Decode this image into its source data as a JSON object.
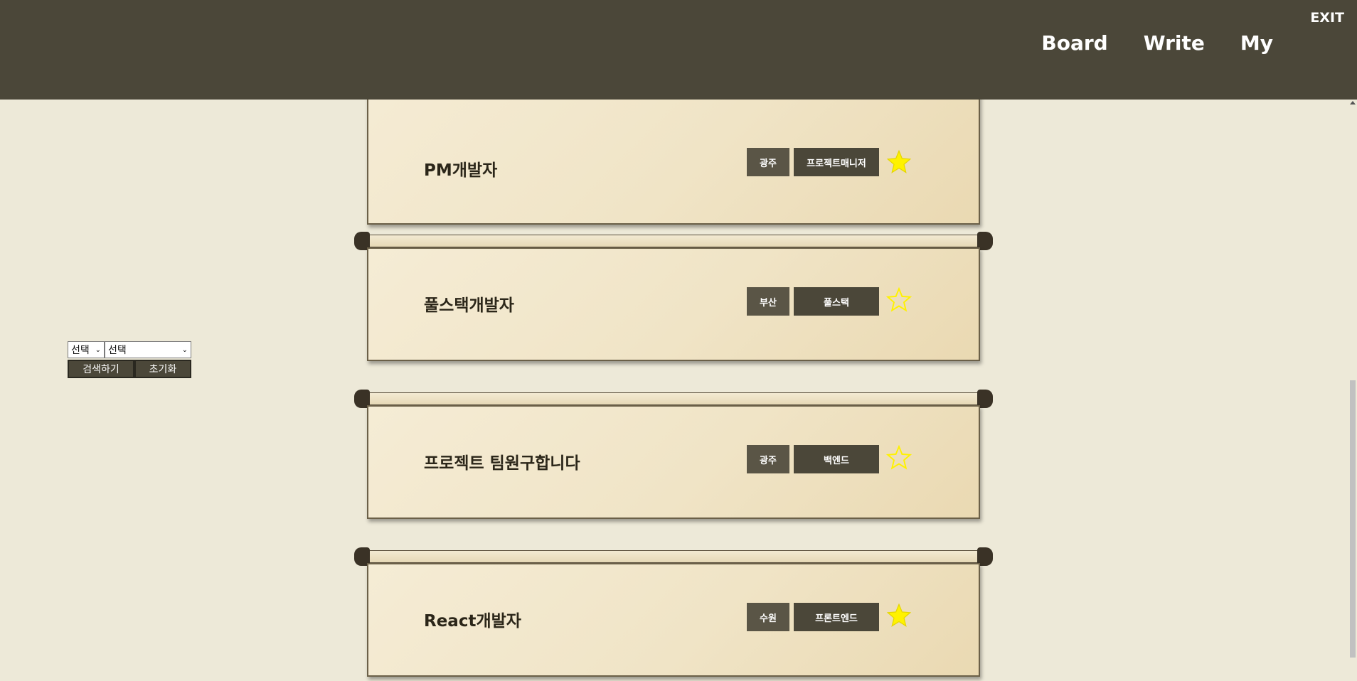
{
  "header": {
    "exit_label": "EXIT",
    "nav": [
      {
        "label": "Board"
      },
      {
        "label": "Write"
      },
      {
        "label": "My"
      }
    ]
  },
  "search": {
    "select1_value": "선택",
    "select2_value": "선택",
    "search_button": "검색하기",
    "reset_button": "초기화"
  },
  "posts": [
    {
      "title": "PM개발자",
      "region": "광주",
      "role": "프로젝트매니저",
      "starred": true
    },
    {
      "title": "풀스택개발자",
      "region": "부산",
      "role": "풀스택",
      "starred": false
    },
    {
      "title": "프로젝트 팀원구합니다",
      "region": "광주",
      "role": "백엔드",
      "starred": false
    },
    {
      "title": "React개발자",
      "region": "수원",
      "role": "프론트엔드",
      "starred": true
    }
  ],
  "colors": {
    "header_bg": "#4b4739",
    "page_bg": "#ede9d8",
    "star_fill": "#fff200",
    "tag_bg": "#4b4739"
  }
}
